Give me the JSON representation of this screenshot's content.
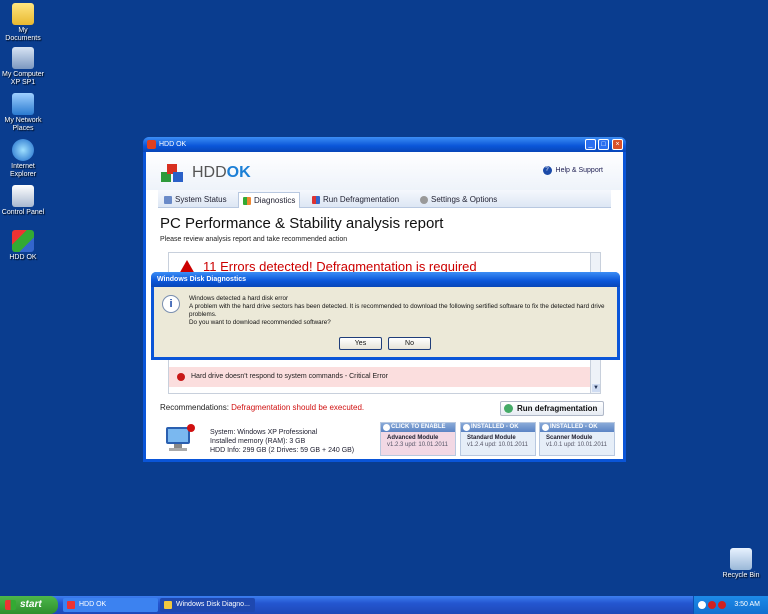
{
  "desktop": {
    "icons": [
      {
        "label": "My Documents",
        "icon": "folder-icon"
      },
      {
        "label": "My Computer XP SP1",
        "icon": "computer-icon"
      },
      {
        "label": "My Network Places",
        "icon": "network-icon"
      },
      {
        "label": "Internet Explorer",
        "icon": "ie-icon"
      },
      {
        "label": "Control Panel",
        "icon": "control-panel-icon"
      },
      {
        "label": "HDD OK",
        "icon": "hddok-icon"
      }
    ],
    "recycle_bin": "Recycle Bin"
  },
  "main_window": {
    "title": "HDD OK",
    "brand_prefix": "HDD",
    "brand_suffix": "OK",
    "help": "Help & Support",
    "tabs": [
      {
        "label": "System Status"
      },
      {
        "label": "Diagnostics"
      },
      {
        "label": "Run Defragmentation"
      },
      {
        "label": "Settings & Options"
      }
    ],
    "report_title": "PC Performance & Stability analysis report",
    "report_subtitle": "Please review analysis report and take recommended action",
    "error_heading": "11 Errors detected! Defragmentation is required",
    "error_item": "Hard drive doesn't respond to system commands - Critical Error",
    "recommendations_label": "Recommendations:",
    "recommendations_value": "Defragmentation should be executed.",
    "run_button": "Run defragmentation",
    "system_info": {
      "system": "System: Windows XP Professional",
      "memory": "Installed memory (RAM): 3 GB",
      "hdd": "HDD Info: 299 GB (2 Drives: 59 GB + 240 GB)"
    },
    "modules": [
      {
        "status": "CLICK TO ENABLE",
        "name": "Advanced Module",
        "version": "v1.2.3 upd: 10.01.2011"
      },
      {
        "status": "INSTALLED - OK",
        "name": "Standard Module",
        "version": "v1.2.4 upd: 10.01.2011"
      },
      {
        "status": "INSTALLED - OK",
        "name": "Scanner Module",
        "version": "v1.0.1 upd: 10.01.2011"
      }
    ]
  },
  "dialog": {
    "title": "Windows Disk Diagnostics",
    "line1": "Windows detected a hard disk error",
    "line2": "A problem with the hard drive sectors has been detected. It is recommended to download the following sertified software to fix the detected hard drive problems.",
    "line3": "Do you want to download recommended software?",
    "yes": "Yes",
    "no": "No"
  },
  "taskbar": {
    "start": "start",
    "tasks": [
      {
        "label": "HDD OK"
      },
      {
        "label": "Windows Disk Diagno..."
      }
    ],
    "clock": "3:50 AM"
  }
}
